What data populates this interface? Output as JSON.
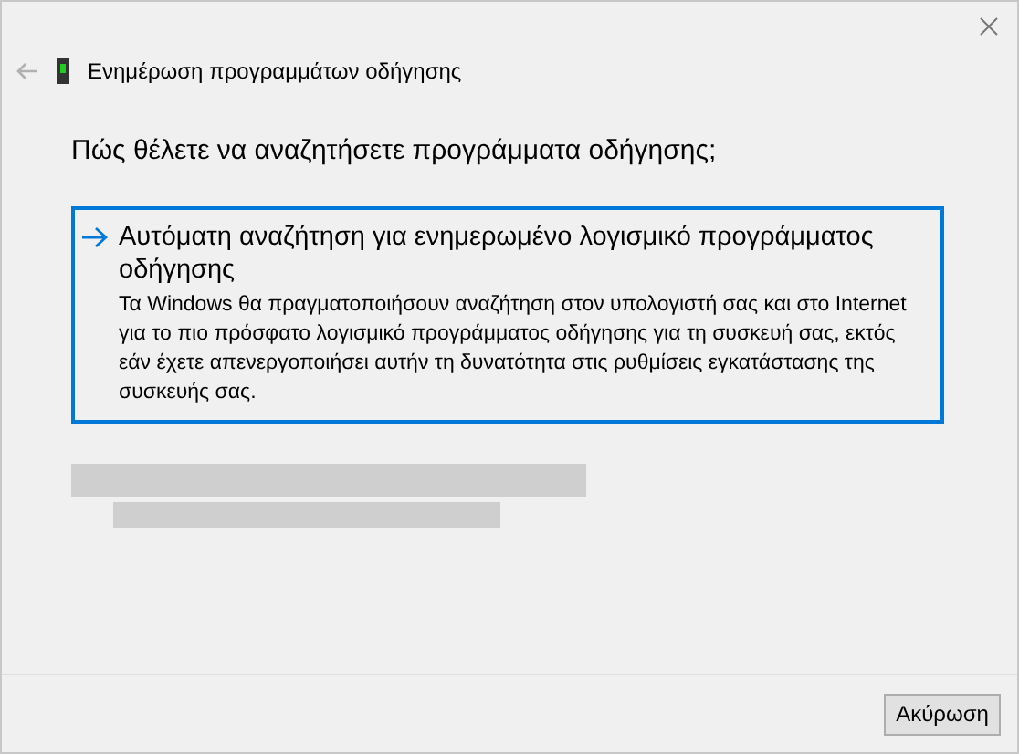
{
  "window": {
    "title": "Ενημέρωση προγραμμάτων οδήγησης"
  },
  "heading": "Πώς θέλετε να αναζητήσετε προγράμματα οδήγησης;",
  "options": [
    {
      "title": "Αυτόματη αναζήτηση για ενημερωμένο λογισμικό προγράμματος οδήγησης",
      "description": "Τα Windows θα πραγματοποιήσουν αναζήτηση στον υπολογιστή σας και στο Internet για το πιο πρόσφατο λογισμικό προγράμματος οδήγησης για τη συσκευή σας, εκτός εάν έχετε απενεργοποιήσει αυτήν τη δυνατότητα στις ρυθμίσεις εγκατάστασης της συσκευής σας.",
      "selected": true
    }
  ],
  "buttons": [
    "Ακύρωση"
  ]
}
